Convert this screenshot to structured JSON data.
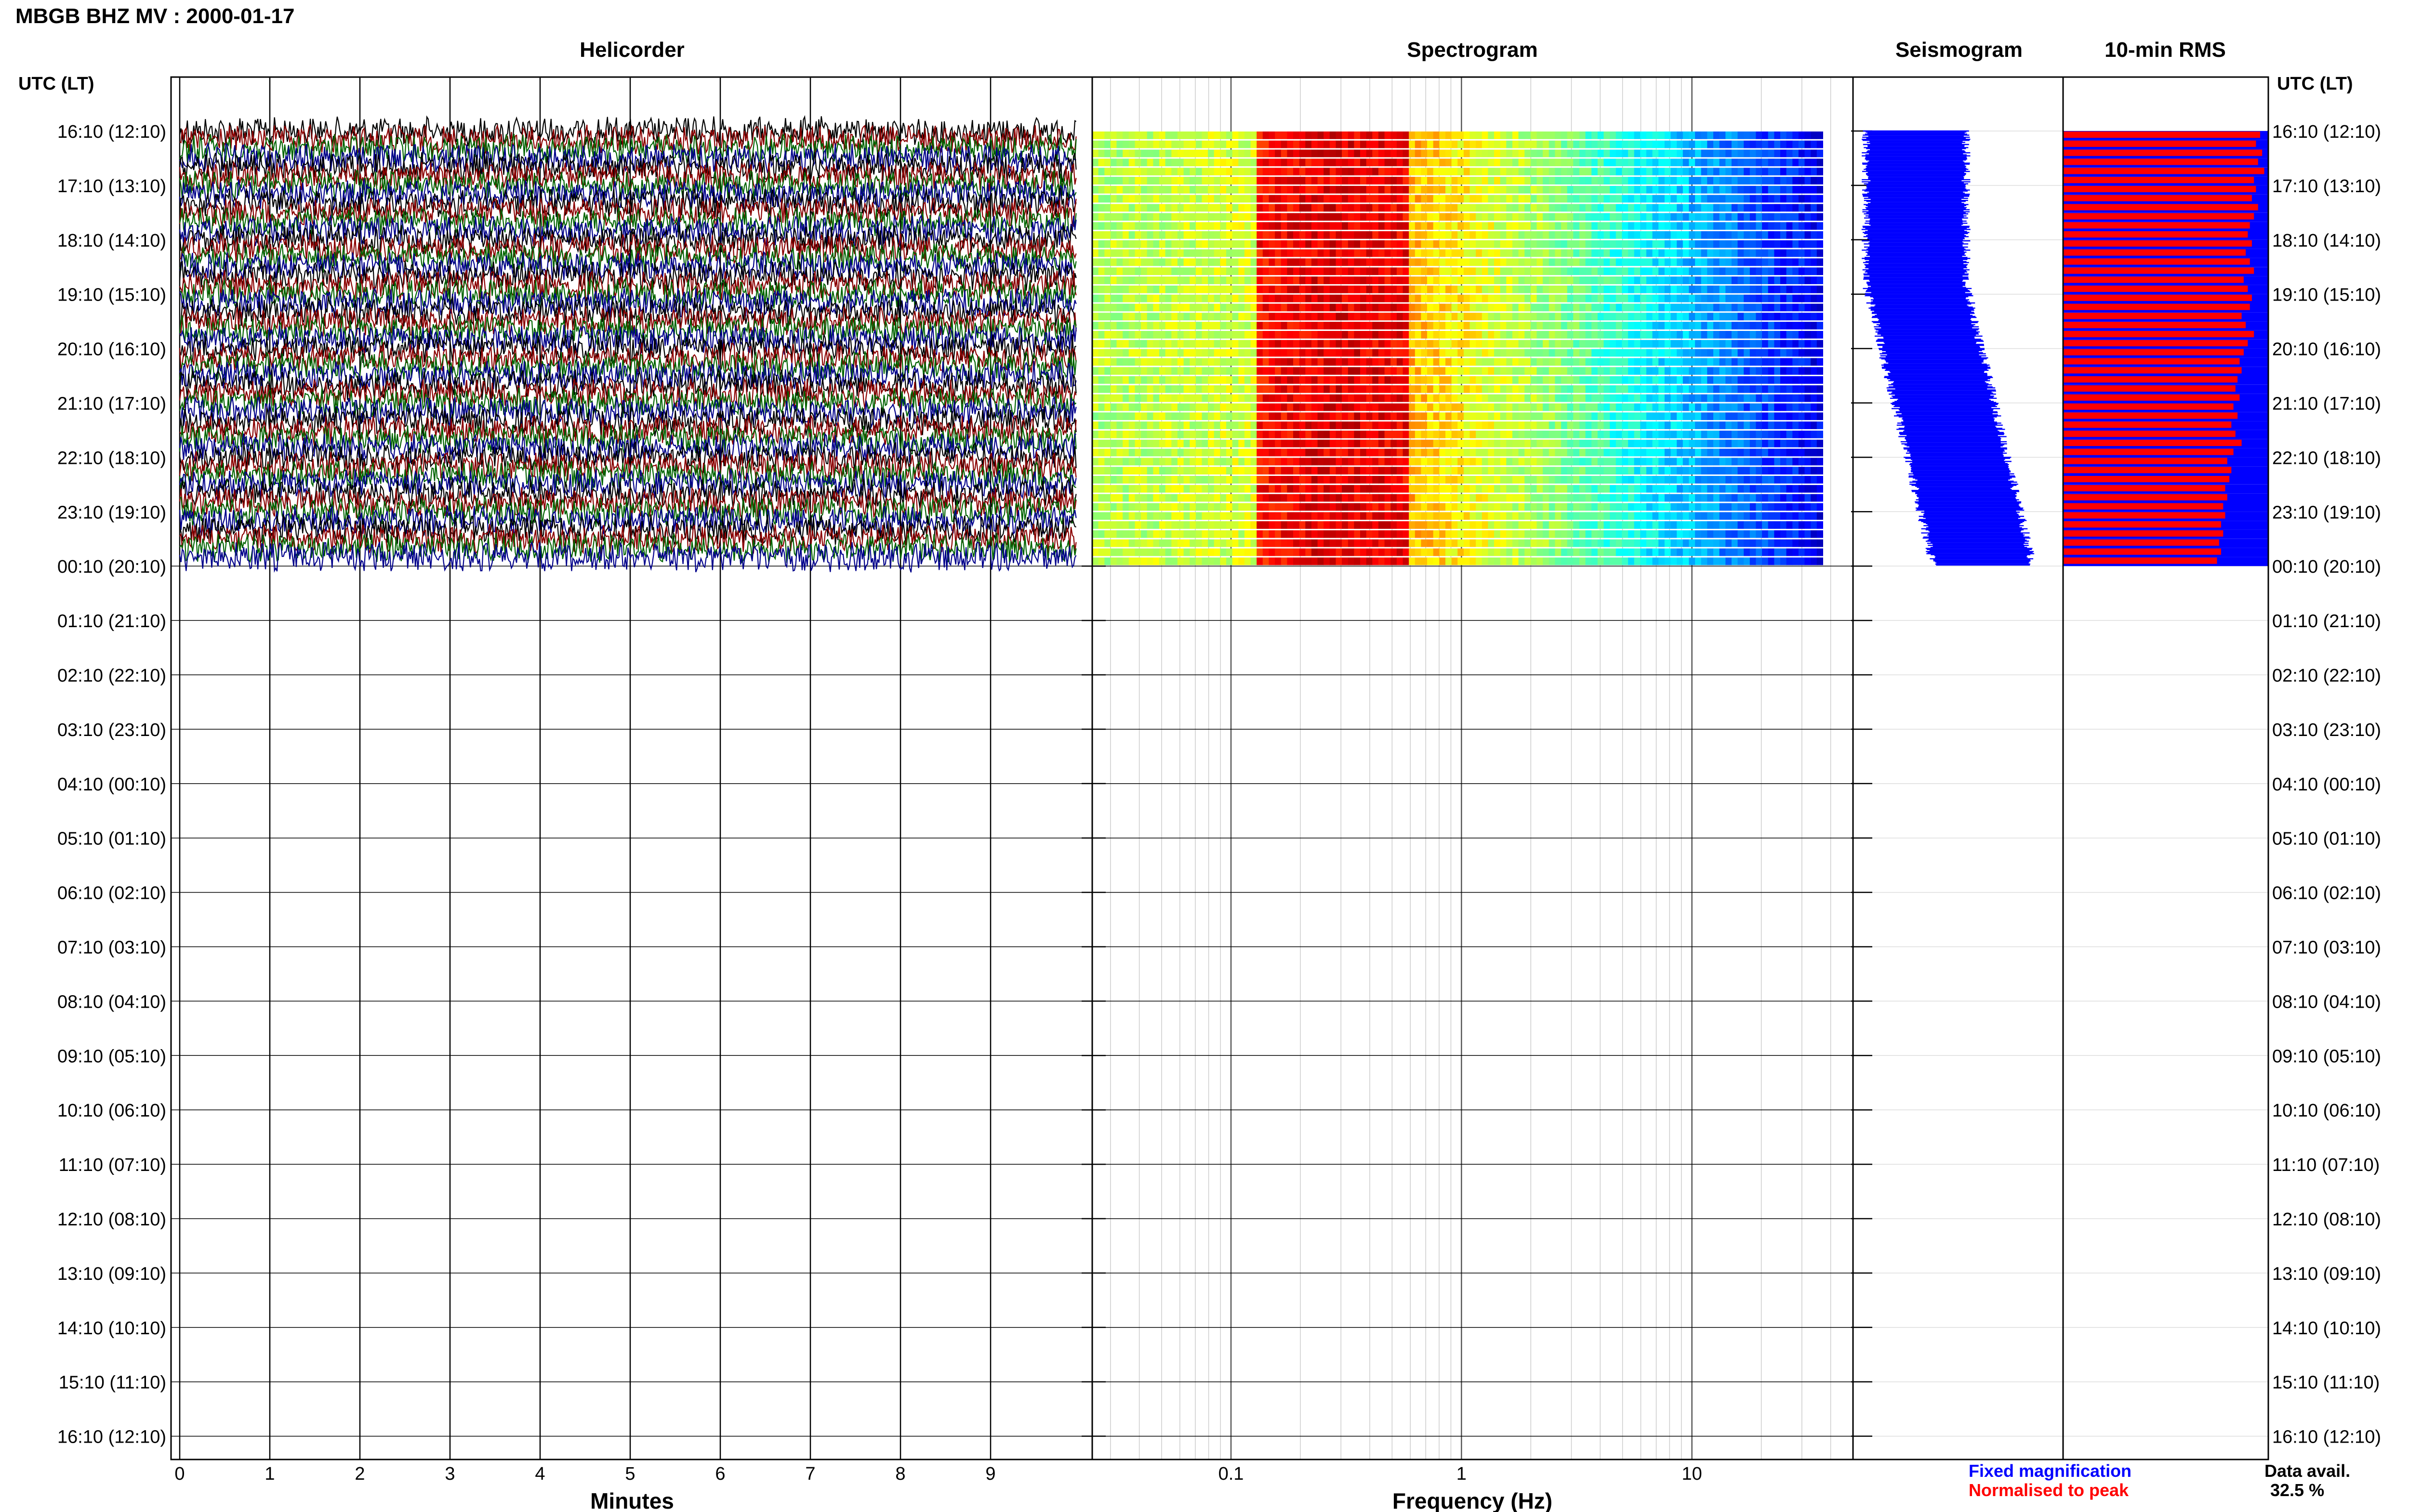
{
  "page": {
    "title": "MBGB BHZ MV : 2000-01-17",
    "utc_label": "UTC (LT)",
    "data_avail_label": "Data avail.",
    "data_avail_value": "32.5 %",
    "legend_fixed": "Fixed magnification",
    "legend_norm": "Normalised to peak"
  },
  "colors": {
    "fixed": "#0000ff",
    "normalised": "#ff0000",
    "heli_traces": [
      "#000000",
      "#8b0000",
      "#006400",
      "#00008b"
    ]
  },
  "chart_data": [
    {
      "type": "line",
      "name": "helicorder",
      "title": "Helicorder",
      "xlabel": "Minutes",
      "x_ticks": [
        0,
        1,
        2,
        3,
        4,
        5,
        6,
        7,
        8,
        9
      ],
      "xlim": [
        0,
        10
      ],
      "row_labels": [
        "16:10 (12:10)",
        "17:10 (13:10)",
        "18:10 (14:10)",
        "19:10 (15:10)",
        "20:10 (16:10)",
        "21:10 (17:10)",
        "22:10 (18:10)",
        "23:10 (19:10)",
        "00:10 (20:10)",
        "01:10 (21:10)",
        "02:10 (22:10)",
        "03:10 (23:10)",
        "04:10 (00:10)",
        "05:10 (01:10)",
        "06:10 (02:10)",
        "07:10 (03:10)",
        "08:10 (04:10)",
        "09:10 (05:10)",
        "10:10 (06:10)",
        "11:10 (07:10)",
        "12:10 (08:10)",
        "13:10 (09:10)",
        "14:10 (10:10)",
        "15:10 (11:10)",
        "16:10 (12:10)"
      ],
      "right_labels": [
        "16:10 (12:10)",
        "17:10 (13:10)",
        "18:10 (14:10)",
        "19:10 (15:10)",
        "20:10 (16:10)",
        "21:10 (17:10)",
        "22:10 (18:10)",
        "23:10 (19:10)",
        "00:10 (20:10)",
        "01:10 (21:10)",
        "02:10 (22:10)",
        "03:10 (23:10)",
        "04:10 (00:10)",
        "05:10 (01:10)",
        "06:10 (02:10)",
        "07:10 (03:10)",
        "08:10 (04:10)",
        "09:10 (05:10)",
        "10:10 (06:10)",
        "11:10 (07:10)",
        "12:10 (08:10)",
        "13:10 (09:10)",
        "14:10 (10:10)",
        "15:10 (11:10)",
        "16:10 (12:10)"
      ],
      "traces_hours": 8,
      "traces_per_hour": 6,
      "grid": true
    },
    {
      "type": "heatmap",
      "name": "spectrogram",
      "title": "Spectrogram",
      "xlabel": "Frequency (Hz)",
      "x_scale": "log",
      "xlim": [
        0.025,
        50
      ],
      "x_ticks": [
        0.1,
        1,
        10
      ],
      "x_tick_labels": [
        "0.1",
        "1",
        "10"
      ],
      "data_fmax": 37,
      "rows": 48,
      "colormap": "jet"
    },
    {
      "type": "bar",
      "name": "seismogram",
      "title": "Seismogram",
      "rows": 48,
      "description_values": {
        "center_start": 0.3,
        "center_mid": 0.3,
        "center_end": 0.62,
        "half_width": 0.24
      }
    },
    {
      "type": "bar",
      "name": "rms",
      "title": "10-min RMS",
      "rows": 48,
      "series": [
        {
          "name": "Fixed magnification",
          "value": 1.0
        },
        {
          "name": "Normalised to peak"
        }
      ],
      "normalised_values": [
        0.96,
        0.94,
        0.97,
        0.95,
        0.98,
        0.93,
        0.94,
        0.92,
        0.95,
        0.93,
        0.91,
        0.9,
        0.92,
        0.89,
        0.91,
        0.93,
        0.88,
        0.9,
        0.92,
        0.91,
        0.87,
        0.89,
        0.93,
        0.9,
        0.88,
        0.86,
        0.87,
        0.85,
        0.84,
        0.86,
        0.83,
        0.85,
        0.82,
        0.84,
        0.87,
        0.83,
        0.8,
        0.82,
        0.81,
        0.79,
        0.8,
        0.78,
        0.79,
        0.77,
        0.78,
        0.76,
        0.77,
        0.75
      ]
    }
  ]
}
